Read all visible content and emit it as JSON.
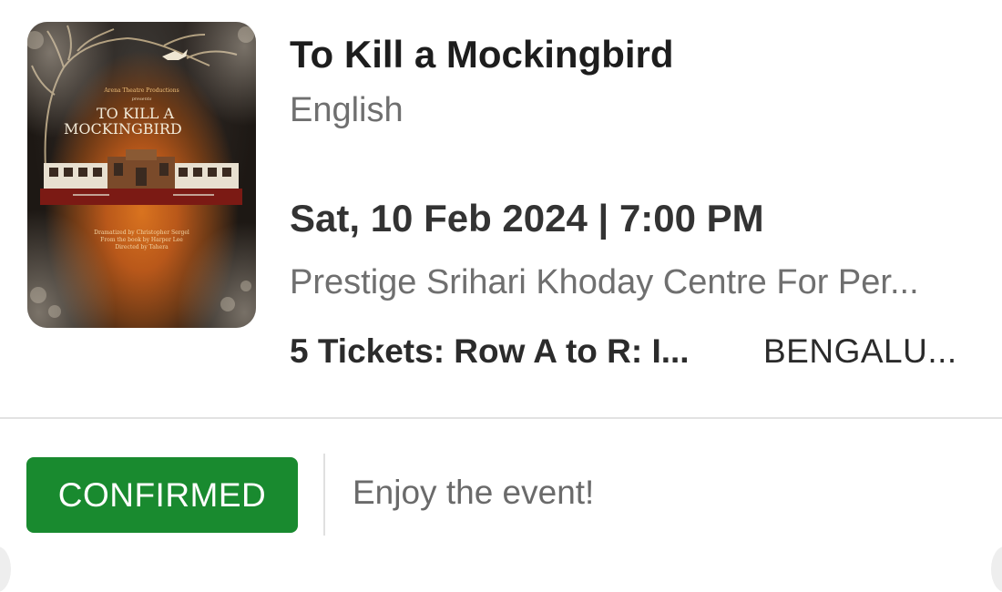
{
  "event": {
    "title": "To Kill a Mockingbird",
    "language": "English",
    "datetime": "Sat, 10 Feb 2024 | 7:00 PM",
    "venue": "Prestige Srihari Khoday Centre For Per...",
    "tickets": "5 Tickets: Row A to R: I...",
    "city": "BENGALU..."
  },
  "poster": {
    "producer": "Arena Theatre Productions",
    "presents": "presents",
    "title_line1": "TO KILL A",
    "title_line2": "MOCKINGBIRD",
    "credit_1": "Dramatized by Christopher Sergel",
    "credit_2": "From the book by Harper Lee",
    "credit_3": "Directed by Tahera"
  },
  "status": {
    "badge": "CONFIRMED",
    "message": "Enjoy the event!",
    "badge_color": "#198a2f"
  }
}
